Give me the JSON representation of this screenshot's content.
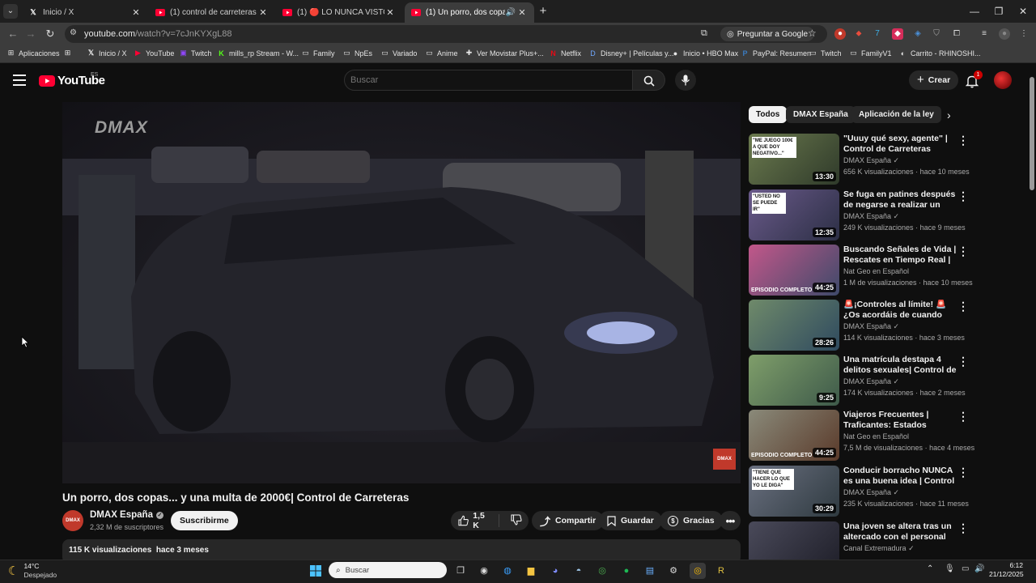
{
  "tabs": [
    {
      "label": "Inicio / X",
      "active": false
    },
    {
      "label": "(1) control de carreteras 09",
      "active": false
    },
    {
      "label": "(1) 🔴 LO NUNCA VISTO 🔴 de",
      "active": false
    },
    {
      "label": "(1) Un porro, dos copas... y",
      "active": true
    }
  ],
  "browser": {
    "url_host": "youtube.com",
    "url_path": "/watch?v=7cJnKYXgL88",
    "google_button": "Preguntar a Google"
  },
  "bookmarks": [
    "Aplicaciones",
    "Inicio / X",
    "YouTube",
    "Twitch",
    "mills_rp Stream - W...",
    "Family",
    "NpEs",
    "Variado",
    "Anime",
    "Ver Movistar Plus+...",
    "Netflix",
    "Disney+ | Películas y...",
    "Inicio • HBO Max",
    "PayPal: Resumen",
    "Twitch",
    "FamilyV1",
    "Carrito - RHINOSHI..."
  ],
  "header": {
    "logo_text": "YouTube",
    "region": "ES",
    "search_placeholder": "Buscar",
    "create_label": "Crear",
    "notif_count": "1"
  },
  "video": {
    "title": "Un porro, dos copas... y una multa de 2000€| Control de Carreteras",
    "watermark": "DMAX",
    "channel": "DMAX España",
    "subscribers": "2,32 M de suscriptores",
    "subscribe_label": "Suscribirme",
    "likes": "1,5 K",
    "share_label": "Compartir",
    "save_label": "Guardar",
    "thanks_label": "Gracias",
    "views": "115 K visualizaciones",
    "age": "hace 3 meses",
    "avatar_text": "DMAX"
  },
  "chips": [
    "Todos",
    "DMAX España",
    "Aplicación de la ley"
  ],
  "recommendations": [
    {
      "title": "\"Uuuy qué sexy, agente\" | Control de Carreteras",
      "channel": "DMAX España",
      "verified": true,
      "views": "656 K visualizaciones",
      "age": "hace 10 meses",
      "duration": "13:30",
      "thumb_text": "\"ME JUEGO 100€ A QUE DOY NEGATIVO...\"",
      "thumb_color": "#5b6b4a"
    },
    {
      "title": "Se fuga en patines después de negarse a realizar un test de ...",
      "channel": "DMAX España",
      "verified": true,
      "views": "249 K visualizaciones",
      "age": "hace 9 meses",
      "duration": "12:35",
      "thumb_text": "\"USTED NO SE PUEDE IR\"",
      "thumb_color": "#4a4f6b"
    },
    {
      "title": "Buscando Señales de Vida | Rescates en Tiempo Real | Nat...",
      "channel": "Nat Geo en Español",
      "verified": false,
      "views": "1 M de visualizaciones",
      "age": "hace 10 meses",
      "duration": "44:25",
      "thumb_text": "EPISODIO COMPLETO",
      "thumb_color": "#8a4b6b"
    },
    {
      "title": "🚨¡Controles al límite! 🚨 ¿Os acordáis de cuando nos ...",
      "channel": "DMAX España",
      "verified": true,
      "views": "114 K visualizaciones",
      "age": "hace 3 meses",
      "duration": "28:26",
      "thumb_text": "",
      "thumb_color": "#3f5a6a"
    },
    {
      "title": "Una matrícula destapa 4 delitos sexuales| Control de Carreteras",
      "channel": "DMAX España",
      "verified": true,
      "views": "174 K visualizaciones",
      "age": "hace 2 meses",
      "duration": "9:25",
      "thumb_text": "",
      "thumb_color": "#4f6f5a"
    },
    {
      "title": "Viajeros Frecuentes | Traficantes: Estados Unidos | ...",
      "channel": "Nat Geo en Español",
      "verified": false,
      "views": "7,5 M de visualizaciones",
      "age": "hace 4 meses",
      "duration": "44:25",
      "thumb_text": "EPISODIO COMPLETO",
      "thumb_color": "#6b5a4a"
    },
    {
      "title": "Conducir borracho NUNCA es una buena idea | Control de ...",
      "channel": "DMAX España",
      "verified": true,
      "views": "235 K visualizaciones",
      "age": "hace 11 meses",
      "duration": "30:29",
      "thumb_text": "\"TIENE QUE HACER LO QUE YO LE DIGA\"",
      "thumb_color": "#4e5560"
    },
    {
      "title": "Una joven se altera tras un altercado con el personal de ...",
      "channel": "Canal Extremadura",
      "verified": true,
      "views": "",
      "age": "",
      "duration": "",
      "thumb_text": "",
      "thumb_color": "#3a3a48"
    }
  ],
  "taskbar": {
    "temp": "14°C",
    "weather": "Despejado",
    "search_placeholder": "Buscar",
    "time": "6:12",
    "date": "21/12/2025"
  }
}
